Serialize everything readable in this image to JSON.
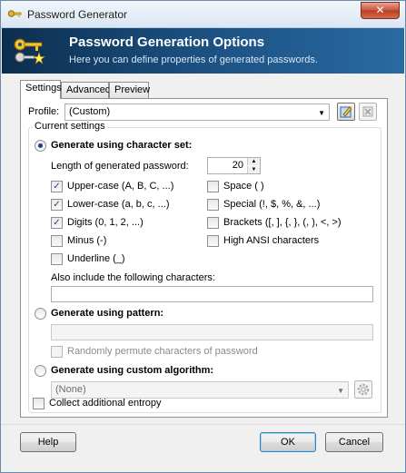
{
  "window": {
    "title": "Password Generator",
    "close_glyph": "✕"
  },
  "banner": {
    "title": "Password Generation Options",
    "subtitle": "Here you can define properties of generated passwords."
  },
  "tabs": [
    {
      "label": "Settings",
      "active": true
    },
    {
      "label": "Advanced",
      "active": false
    },
    {
      "label": "Preview",
      "active": false
    }
  ],
  "profile": {
    "label": "Profile:",
    "value": "(Custom)"
  },
  "current_settings": {
    "legend": "Current settings",
    "charset_option": {
      "label": "Generate using character set:",
      "selected": true
    },
    "length": {
      "label": "Length of generated password:",
      "value": "20"
    },
    "checkboxes_left": [
      {
        "label": "Upper-case (A, B, C, ...)",
        "checked": true
      },
      {
        "label": "Lower-case (a, b, c, ...)",
        "checked": true
      },
      {
        "label": "Digits (0, 1, 2, ...)",
        "checked": true
      },
      {
        "label": "Minus (-)",
        "checked": false
      },
      {
        "label": "Underline (_)",
        "checked": false
      }
    ],
    "checkboxes_right": [
      {
        "label": "Space ( )",
        "checked": false
      },
      {
        "label": "Special (!, $, %, &, ...)",
        "checked": false
      },
      {
        "label": "Brackets ([, ], {, }, (, ), <, >)",
        "checked": false
      },
      {
        "label": "High ANSI characters",
        "checked": false
      }
    ],
    "include_label": "Also include the following characters:",
    "include_value": "",
    "pattern_option": {
      "label": "Generate using pattern:",
      "selected": false
    },
    "pattern_value": "",
    "permute_label": "Randomly permute characters of password",
    "custom_option": {
      "label": "Generate using custom algorithm:",
      "selected": false
    },
    "custom_value": "(None)"
  },
  "entropy_label": "Collect additional entropy",
  "buttons": {
    "help": "Help",
    "ok": "OK",
    "cancel": "Cancel"
  },
  "check_glyph": "✓",
  "icons": [
    "key-icon",
    "save-profile-icon",
    "delete-profile-icon",
    "gear-icon",
    "close-icon"
  ]
}
